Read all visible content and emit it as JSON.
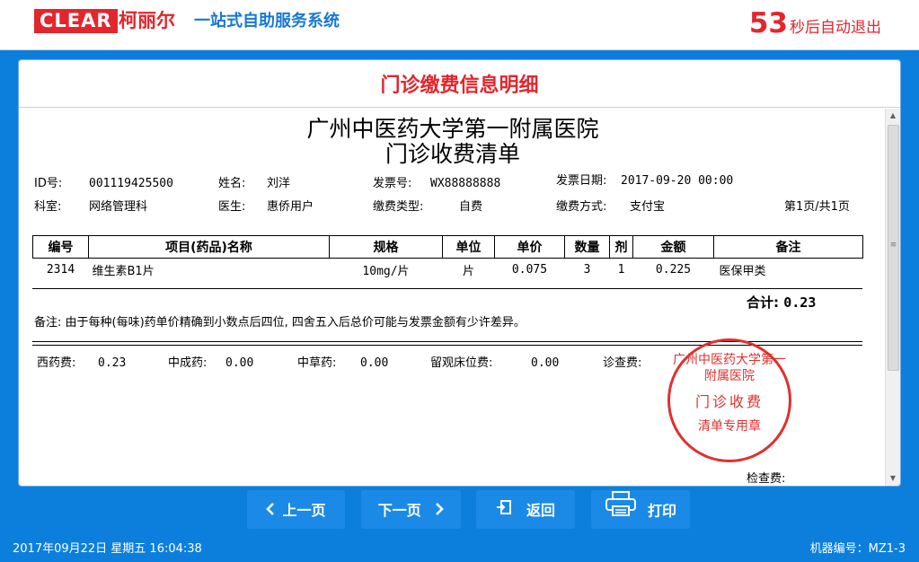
{
  "header": {
    "logo_text": "CLEAR",
    "brand_cn": "柯丽尔",
    "system_title": "一站式自助服务系统",
    "countdown_seconds": "53",
    "countdown_text": "秒后自动退出"
  },
  "panel": {
    "title": "门诊缴费信息明细"
  },
  "document": {
    "hospital": "广州中医药大学第一附属医院",
    "subtitle": "门诊收费清单",
    "id_label": "ID号:",
    "id_value": "001119425500",
    "name_label": "姓名:",
    "name_value": "刘洋",
    "invoice_no_label": "发票号:",
    "invoice_no_value": "WX88888888",
    "invoice_date_label": "发票日期:",
    "invoice_date_value": "2017-09-20 00:00",
    "dept_label": "科室:",
    "dept_value": "网络管理科",
    "doctor_label": "医生:",
    "doctor_value": "惠侨用户",
    "pay_type_label": "缴费类型:",
    "pay_type_value": "自费",
    "pay_method_label": "缴费方式:",
    "pay_method_value": "支付宝",
    "page_info": "第1页/共1页",
    "table": {
      "headers": [
        "编号",
        "项目(药品)名称",
        "规格",
        "单位",
        "单价",
        "数量",
        "剂",
        "金额",
        "备注"
      ],
      "rows": [
        [
          "2314",
          "维生素B1片",
          "10mg/片",
          "片",
          "0.075",
          "3",
          "1",
          "0.225",
          "医保甲类"
        ]
      ]
    },
    "total_label": "合计:",
    "total_value": "0.23",
    "note": "备注: 由于每种(每味)药单价精确到小数点后四位, 四舍五入后总价可能与发票金额有少许差异。",
    "fees": {
      "western_label": "西药费:",
      "western_value": "0.23",
      "chinese_patent_label": "中成药:",
      "chinese_patent_value": "0.00",
      "herbal_label": "中草药:",
      "herbal_value": "0.00",
      "observation_label": "留观床位费:",
      "observation_value": "0.00",
      "diagnosis_label": "诊查费:",
      "exam_label": "检查费:"
    },
    "stamp": {
      "top": "广州中医药大学第一附属医院",
      "middle": "门诊收费",
      "bottom": "清单专用章"
    }
  },
  "buttons": {
    "prev": "上一页",
    "next": "下一页",
    "back": "返回",
    "print": "打印"
  },
  "footer": {
    "datetime": "2017年09月22日    星期五    16:04:38",
    "machine": "机器编号：MZ1-3"
  }
}
